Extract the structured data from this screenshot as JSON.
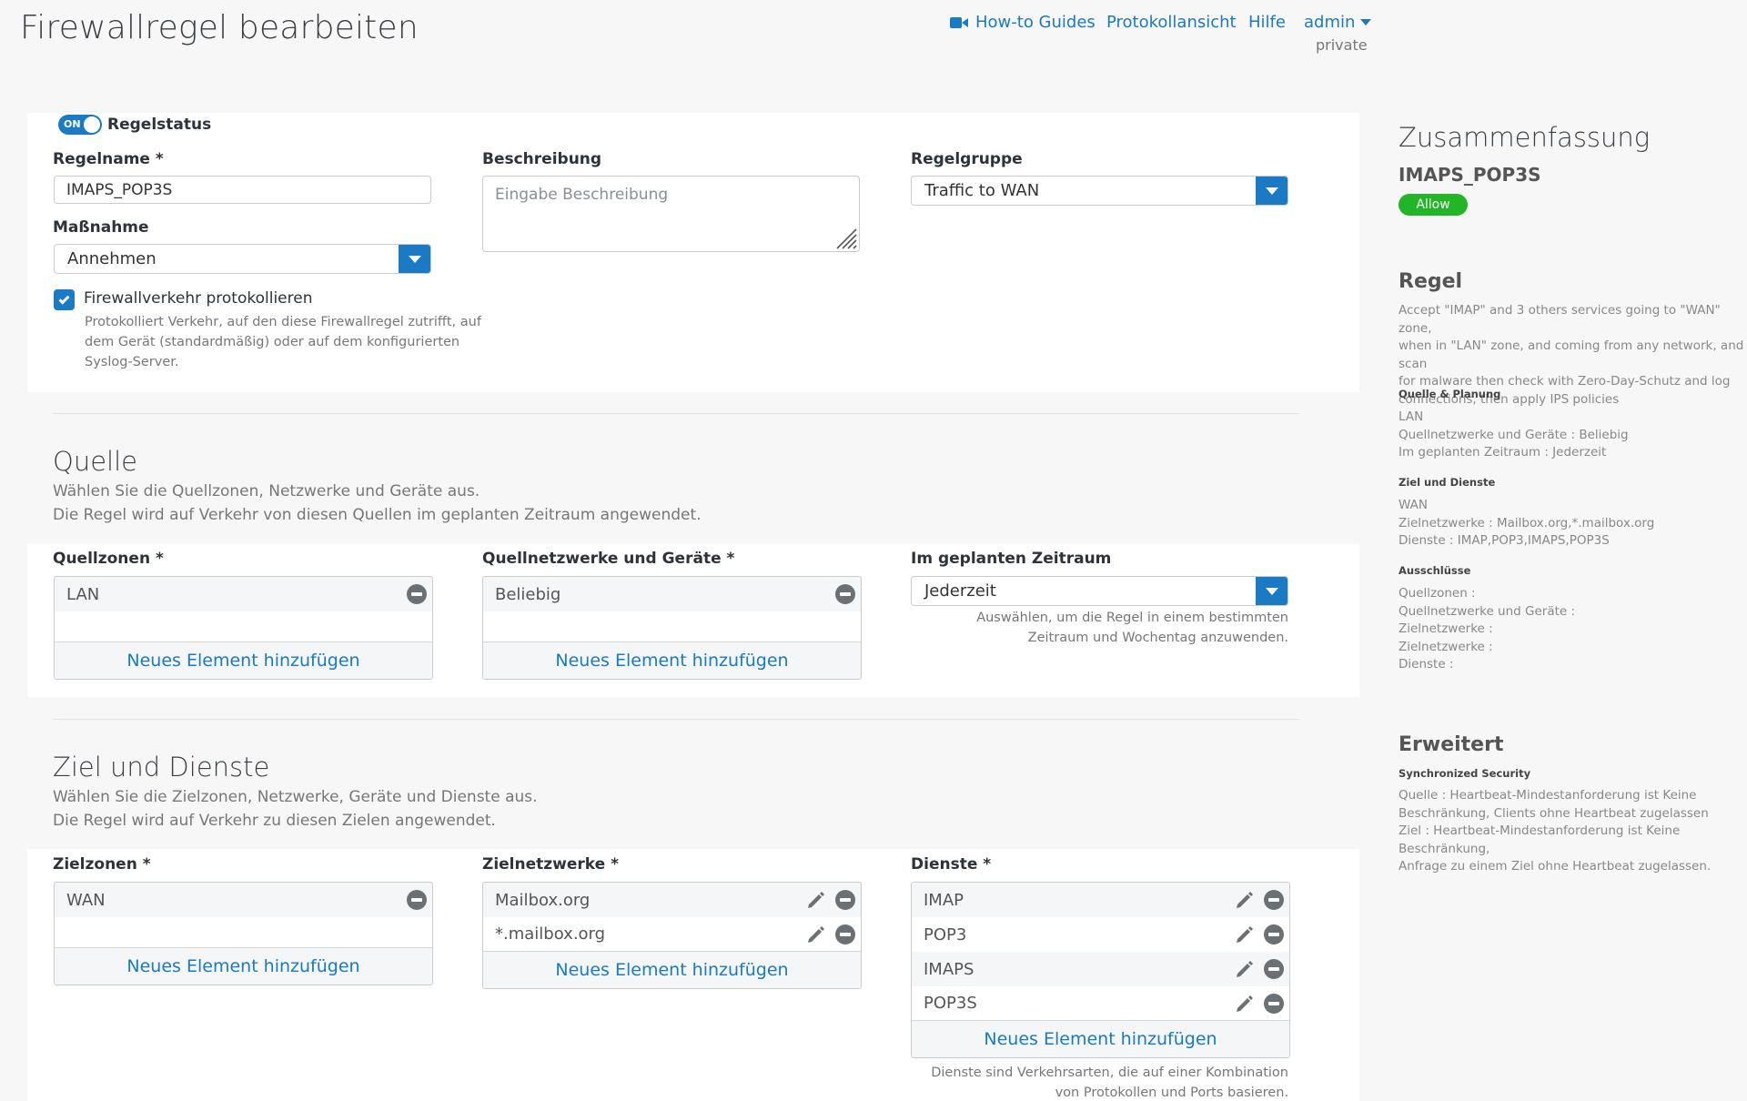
{
  "page": {
    "title": "Firewallregel bearbeiten"
  },
  "topnav": {
    "howto": "How-to Guides",
    "log": "Protokollansicht",
    "help": "Hilfe",
    "admin": "admin",
    "private": "private"
  },
  "rule": {
    "status_toggle": "ON",
    "status_label": "Regelstatus",
    "name_label": "Regelname *",
    "name_value": "IMAPS_POP3S",
    "desc_label": "Beschreibung",
    "desc_placeholder": "Eingabe Beschreibung",
    "group_label": "Regelgruppe",
    "group_value": "Traffic to WAN",
    "action_label": "Maßnahme",
    "action_value": "Annehmen",
    "log_label": "Firewallverkehr protokollieren",
    "log_checked": true,
    "log_help": [
      "Protokolliert Verkehr, auf den diese Firewallregel zutrifft, auf",
      "dem Gerät (standardmäßig) oder auf dem konfigurierten",
      "Syslog-Server."
    ]
  },
  "source": {
    "title": "Quelle",
    "desc": [
      "Wählen Sie die Quellzonen, Netzwerke und Geräte aus.",
      "Die Regel wird auf Verkehr von diesen Quellen im geplanten Zeitraum angewendet."
    ],
    "zones_label": "Quellzonen *",
    "zones": [
      "LAN"
    ],
    "networks_label": "Quellnetzwerke und Geräte *",
    "networks": [
      "Beliebig"
    ],
    "schedule_label": "Im geplanten Zeitraum",
    "schedule_value": "Jederzeit",
    "schedule_help": [
      "Auswählen, um die Regel in einem bestimmten",
      "Zeitraum und Wochentag anzuwenden."
    ],
    "add_label": "Neues Element hinzufügen"
  },
  "dest": {
    "title": "Ziel und Dienste",
    "desc": [
      "Wählen Sie die Zielzonen, Netzwerke, Geräte und Dienste aus.",
      "Die Regel wird auf Verkehr zu diesen Zielen angewendet."
    ],
    "zones_label": "Zielzonen *",
    "zones": [
      "WAN"
    ],
    "networks_label": "Zielnetzwerke *",
    "networks": [
      "Mailbox.org",
      "*.mailbox.org"
    ],
    "services_label": "Dienste *",
    "services": [
      "IMAP",
      "POP3",
      "IMAPS",
      "POP3S"
    ],
    "services_help": [
      "Dienste sind Verkehrsarten, die auf einer Kombination",
      "von Protokollen und Ports basieren."
    ],
    "add_label": "Neues Element hinzufügen"
  },
  "summary": {
    "title": "Zusammenfassung",
    "rule_name": "IMAPS_POP3S",
    "badge": "Allow",
    "badge_color": "#22b527",
    "regel_heading": "Regel",
    "regel_text": [
      "Accept \"IMAP\" and 3 others services going to \"WAN\" zone,",
      "when in \"LAN\" zone, and coming from any network, and scan",
      "for malware then check with Zero-Day-Schutz and log",
      "connections, then apply IPS policies"
    ],
    "quelle_heading": "Quelle & Planung",
    "quelle_lines": [
      "LAN",
      "Quellnetzwerke und Geräte : Beliebig",
      "Im geplanten Zeitraum : Jederzeit"
    ],
    "ziel_heading": "Ziel und Dienste",
    "ziel_lines": [
      "WAN",
      "Zielnetzwerke : Mailbox.org,*.mailbox.org",
      "Dienste : IMAP,POP3,IMAPS,POP3S"
    ],
    "ausschluesse_heading": "Ausschlüsse",
    "ausschluesse_lines": [
      "Quellzonen :",
      "Quellnetzwerke und Geräte :",
      "Zielnetzwerke :",
      "Zielnetzwerke :",
      "Dienste :"
    ],
    "erweitert_heading": "Erweitert",
    "sync_heading": "Synchronized Security",
    "sync_lines": [
      "Quelle : Heartbeat-Mindestanforderung ist Keine",
      "Beschränkung, Clients ohne Heartbeat zugelassen",
      "Ziel : Heartbeat-Mindestanforderung ist Keine Beschränkung,",
      "Anfrage zu einem Ziel ohne Heartbeat zugelassen."
    ]
  },
  "colors": {
    "accent": "#1a7ac4",
    "allow": "#22b527"
  }
}
